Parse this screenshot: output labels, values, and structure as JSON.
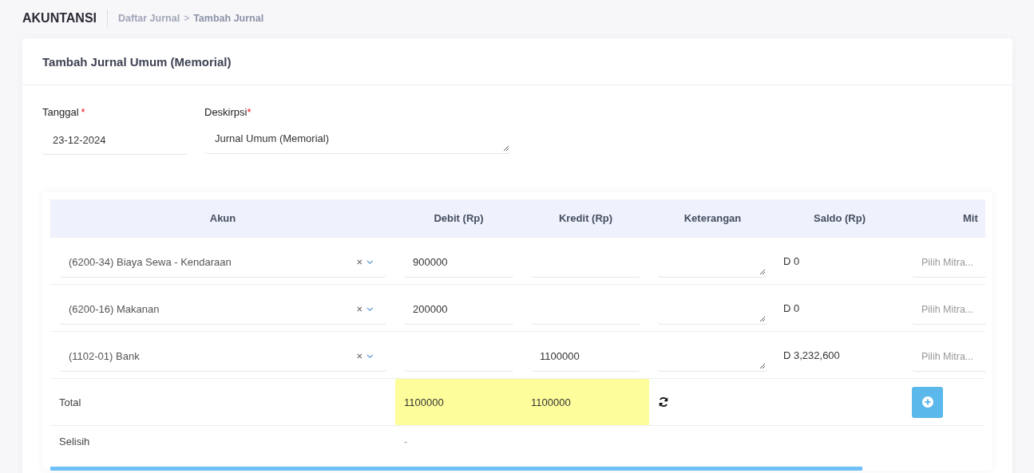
{
  "header": {
    "app": "AKUNTANSI",
    "breadcrumb": [
      {
        "label": "Daftar Jurnal",
        "current": false
      },
      {
        "label": "Tambah Jurnal",
        "current": true
      }
    ],
    "separator": ">"
  },
  "card": {
    "title": "Tambah Jurnal Umum (Memorial)"
  },
  "form": {
    "date": {
      "label": "Tanggal",
      "required_mark": "*",
      "value": "23-12-2024"
    },
    "description": {
      "label": "Deskirpsi",
      "required_mark": "*",
      "value": "Jurnal Umum (Memorial)"
    }
  },
  "table": {
    "columns": [
      "Akun",
      "Debit (Rp)",
      "Kredit (Rp)",
      "Keterangan",
      "Saldo (Rp)",
      "Mit"
    ],
    "rows": [
      {
        "account": "(6200-34) Biaya Sewa - Kendaraan",
        "debit": "900000",
        "kredit": "",
        "saldo": "D 0",
        "mitra_placeholder": "Pilih Mitra..."
      },
      {
        "account": "(6200-16) Makanan",
        "debit": "200000",
        "kredit": "",
        "saldo": "D 0",
        "mitra_placeholder": "Pilih Mitra..."
      },
      {
        "account": "(1102-01) Bank",
        "debit": "",
        "kredit": "1100000",
        "saldo": "D 3,232,600",
        "mitra_placeholder": "Pilih Mitra..."
      }
    ],
    "total": {
      "label": "Total",
      "debit": "1100000",
      "kredit": "1100000"
    },
    "difference": {
      "label": "Selisih",
      "value": "-"
    }
  }
}
